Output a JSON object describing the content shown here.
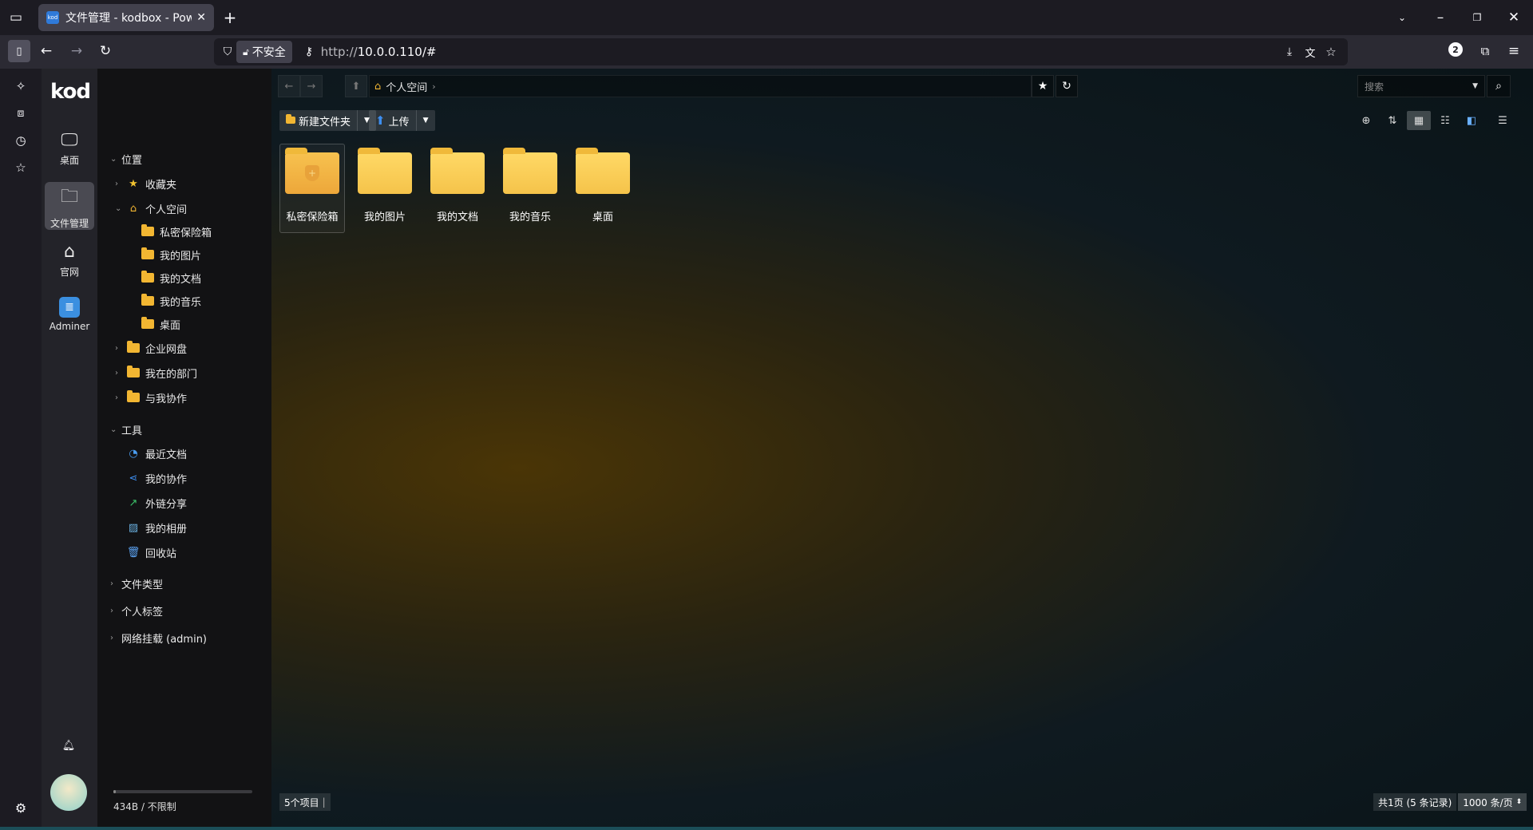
{
  "browser": {
    "tab_title": "文件管理 - kodbox - Powered",
    "favicon_text": "kod",
    "security_label": "不安全",
    "url_prefix": "http://",
    "url_host": "10.0.0.110/#",
    "profile_badge": "2"
  },
  "app": {
    "logo": "kod",
    "nav": [
      {
        "label": "桌面",
        "icon": "monitor-icon"
      },
      {
        "label": "文件管理",
        "icon": "folder-icon",
        "active": true
      },
      {
        "label": "官网",
        "icon": "home-icon"
      },
      {
        "label": "Adminer",
        "icon": "database-icon"
      }
    ]
  },
  "tree": {
    "location_header": "位置",
    "favorites": "收藏夹",
    "personal_space": "个人空间",
    "personal_children": [
      "私密保险箱",
      "我的图片",
      "我的文档",
      "我的音乐",
      "桌面"
    ],
    "enterprise": "企业网盘",
    "my_department": "我在的部门",
    "shared_with_me": "与我协作",
    "tools_header": "工具",
    "tools": [
      {
        "label": "最近文档",
        "icon": "clock-icon"
      },
      {
        "label": "我的协作",
        "icon": "share-icon"
      },
      {
        "label": "外链分享",
        "icon": "link-share-icon"
      },
      {
        "label": "我的相册",
        "icon": "photo-icon"
      },
      {
        "label": "回收站",
        "icon": "trash-icon"
      }
    ],
    "file_types": "文件类型",
    "personal_tags": "个人标签",
    "network_mount": "网络挂载 (admin)",
    "quota_text": "434B / 不限制",
    "quota_fraction": 0.02
  },
  "main": {
    "breadcrumb": "个人空间",
    "search_placeholder": "搜索",
    "new_folder_label": "新建文件夹",
    "upload_label": "上传",
    "files": [
      "私密保险箱",
      "我的图片",
      "我的文档",
      "我的音乐",
      "桌面"
    ],
    "item_count": "5个项目",
    "page_info": "共1页 (5 条记录)",
    "per_page": "1000 条/页"
  },
  "colors": {
    "folder": "#f2b632",
    "accent": "#2f7ad9"
  }
}
